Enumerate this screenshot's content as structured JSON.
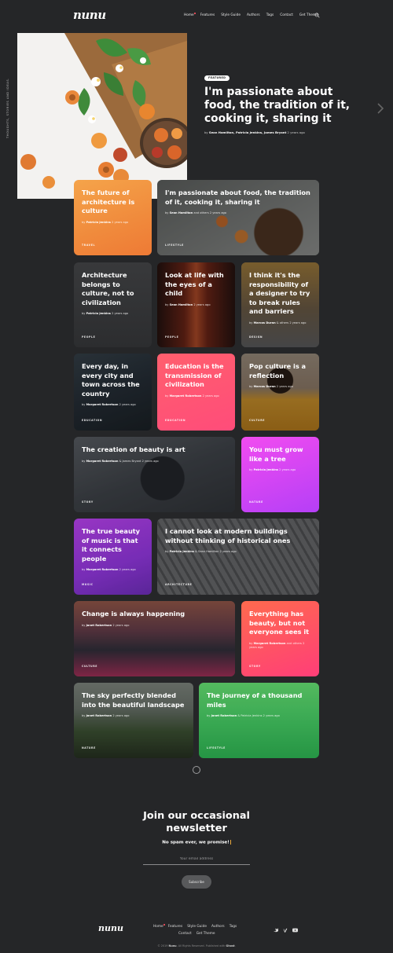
{
  "header": {
    "logo": "nunu",
    "nav": [
      "Home",
      "Features",
      "Style Guide",
      "Authors",
      "Tags",
      "Contact",
      "Get Theme"
    ]
  },
  "side_text": "Thoughts, stories and ideas.",
  "hero": {
    "tag": "FEATURED",
    "title": "I'm passionate about food, the tradition of it, cooking it, sharing it",
    "meta_authors": "Sean Hamilton, Patricia Jenkins, James Bryant",
    "meta_time": "2 years ago"
  },
  "cards": [
    {
      "title": "The future of architecture is culture",
      "by": "Patricia Jenkins",
      "time": "2 years ago",
      "category": "Travel"
    },
    {
      "title": "I'm passionate about food, the tradition of it, cooking it, sharing it",
      "by": "Sean Hamilton",
      "time": "and others 2 years ago",
      "category": "Lifestyle"
    },
    {
      "title": "Architecture belongs to culture, not to civilization",
      "by": "Patricia Jenkins",
      "time": "2 years ago",
      "category": "People"
    },
    {
      "title": "Look at life with the eyes of a child",
      "by": "Sean Hamilton",
      "time": "2 years ago",
      "category": "People"
    },
    {
      "title": "I think it's the responsibility of a designer to try to break rules and barriers",
      "by": "Marcos Duran",
      "time": "& others 2 years ago",
      "category": "Design"
    },
    {
      "title": "Every day, in every city and town across the country",
      "by": "Margaret Robertson",
      "time": "2 years ago",
      "category": "Education"
    },
    {
      "title": "Education is the transmission of civilization",
      "by": "Margaret Robertson",
      "time": "2 years ago",
      "category": "Education"
    },
    {
      "title": "Pop culture is a reflection",
      "by": "Marcos Duran",
      "time": "2 years ago",
      "category": "Culture"
    },
    {
      "title": "The creation of beauty is art",
      "by": "Margaret Robertson",
      "time": "& James Bryant 2 years ago",
      "category": "Story"
    },
    {
      "title": "You must grow like a tree",
      "by": "Patricia Jenkins",
      "time": "2 years ago",
      "category": "Nature"
    },
    {
      "title": "The true beauty of music is that it connects people",
      "by": "Margaret Robertson",
      "time": "2 years ago",
      "category": "Music"
    },
    {
      "title": "I cannot look at modern buildings without thinking of historical ones",
      "by": "Patricia Jenkins",
      "time": "& Sean Hamilton 2 years ago",
      "category": "Architecture"
    },
    {
      "title": "Change is always happening",
      "by": "Janet Robertson",
      "time": "2 years ago",
      "category": "Culture"
    },
    {
      "title": "Everything has beauty, but not everyone sees it",
      "by": "Margaret Robertson",
      "time": "and others 2 years ago",
      "category": "Story"
    },
    {
      "title": "The sky perfectly blended into the beautiful landscape",
      "by": "Janet Robertson",
      "time": "2 years ago",
      "category": "Nature"
    },
    {
      "title": "The journey of a thousand miles",
      "by": "Janet Robertson",
      "time": "& Patricia Jenkins 2 years ago",
      "category": "Lifestyle"
    }
  ],
  "newsletter": {
    "title": "Join our occasional newsletter",
    "subtitle": "No spam ever, we promise!",
    "placeholder": "Your email address",
    "button": "Subscribe"
  },
  "footer": {
    "logo": "nunu",
    "nav_row1": [
      "Home",
      "Features",
      "Style Guide",
      "Authors",
      "Tags"
    ],
    "nav_row2": [
      "Contact",
      "Get Theme"
    ],
    "copyright_prefix": "© 2019",
    "copyright_brand": "Nunu",
    "copyright_mid": ". All Rights Reserved. Published with",
    "copyright_ghost": "Ghost"
  }
}
